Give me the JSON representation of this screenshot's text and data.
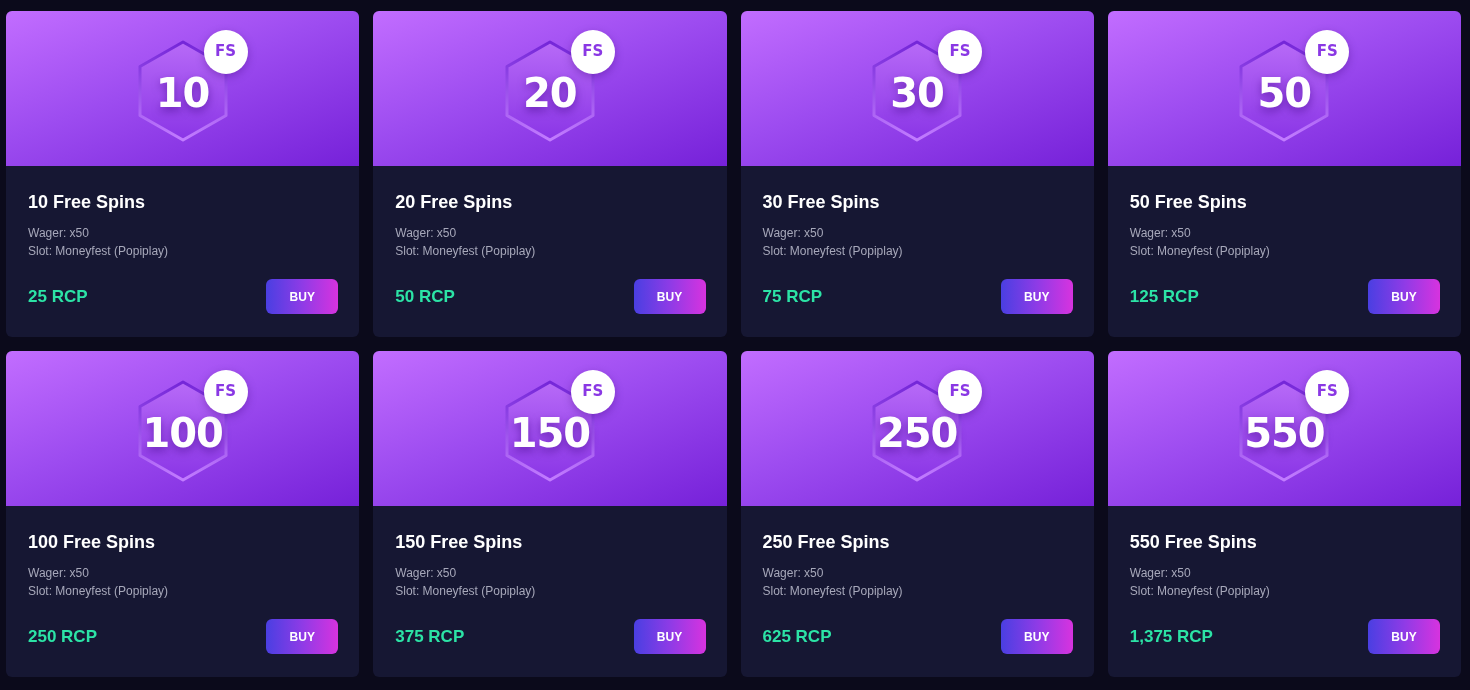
{
  "offers": [
    {
      "badge_number": "10",
      "badge_label": "FS",
      "title": "10 Free Spins",
      "details": [
        "Wager: x50",
        "Slot: Moneyfest (Popiplay)"
      ],
      "price": "25 RCP",
      "button": "BUY"
    },
    {
      "badge_number": "20",
      "badge_label": "FS",
      "title": "20 Free Spins",
      "details": [
        "Wager: x50",
        "Slot: Moneyfest (Popiplay)"
      ],
      "price": "50 RCP",
      "button": "BUY"
    },
    {
      "badge_number": "30",
      "badge_label": "FS",
      "title": "30 Free Spins",
      "details": [
        "Wager: x50",
        "Slot: Moneyfest (Popiplay)"
      ],
      "price": "75 RCP",
      "button": "BUY"
    },
    {
      "badge_number": "50",
      "badge_label": "FS",
      "title": "50 Free Spins",
      "details": [
        "Wager: x50",
        "Slot: Moneyfest (Popiplay)"
      ],
      "price": "125 RCP",
      "button": "BUY"
    },
    {
      "badge_number": "100",
      "badge_label": "FS",
      "title": "100 Free Spins",
      "details": [
        "Wager: x50",
        "Slot: Moneyfest (Popiplay)"
      ],
      "price": "250 RCP",
      "button": "BUY"
    },
    {
      "badge_number": "150",
      "badge_label": "FS",
      "title": "150 Free Spins",
      "details": [
        "Wager: x50",
        "Slot: Moneyfest (Popiplay)"
      ],
      "price": "375 RCP",
      "button": "BUY"
    },
    {
      "badge_number": "250",
      "badge_label": "FS",
      "title": "250 Free Spins",
      "details": [
        "Wager: x50",
        "Slot: Moneyfest (Popiplay)"
      ],
      "price": "625 RCP",
      "button": "BUY"
    },
    {
      "badge_number": "550",
      "badge_label": "FS",
      "title": "550 Free Spins",
      "details": [
        "Wager: x50",
        "Slot: Moneyfest (Popiplay)"
      ],
      "price": "1,375 RCP",
      "button": "BUY"
    }
  ]
}
